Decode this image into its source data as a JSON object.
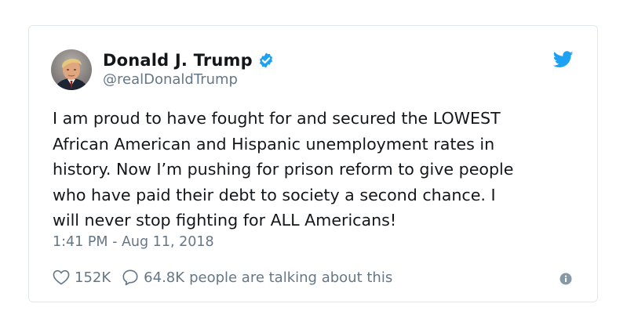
{
  "author": {
    "display_name": "Donald J. Trump",
    "handle": "@realDonaldTrump",
    "verified": true
  },
  "tweet": {
    "text": "I am proud to have fought for and secured the LOWEST\nAfrican American and Hispanic unemployment rates in\nhistory. Now I’m pushing for prison reform to give people\nwho have paid their debt to society a second chance. I\nwill never stop fighting for ALL Americans!",
    "timestamp": "1:41 PM - Aug 11, 2018"
  },
  "engagement": {
    "likes": "152K",
    "replies": "64.8K",
    "replies_suffix": "people are talking about this"
  },
  "icons": {
    "brand": "twitter-bird-icon",
    "verified": "verified-badge-icon",
    "like": "heart-icon",
    "reply": "speech-bubble-icon",
    "info": "info-icon"
  },
  "colors": {
    "brand_blue": "#1da1f2",
    "text_primary": "#14171a",
    "text_secondary": "#657786",
    "border": "#e1e8ed"
  }
}
